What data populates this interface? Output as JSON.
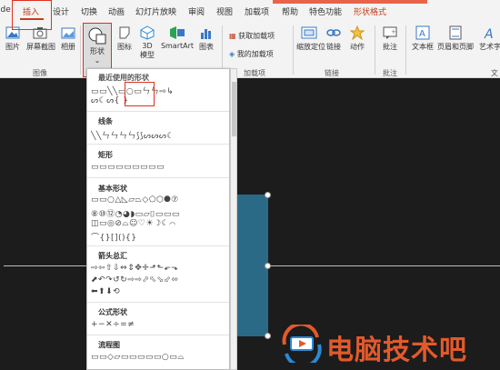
{
  "tabs": [
    {
      "label": "ide"
    },
    {
      "label": "插入"
    },
    {
      "label": "设计"
    },
    {
      "label": "切换"
    },
    {
      "label": "动画"
    },
    {
      "label": "幻灯片放映"
    },
    {
      "label": "审阅"
    },
    {
      "label": "视图"
    },
    {
      "label": "加载项"
    },
    {
      "label": "帮助"
    },
    {
      "label": "特色功能"
    },
    {
      "label": "形状格式"
    }
  ],
  "ribbon": {
    "picture": "图片",
    "screenshot": "屏幕截图",
    "album": "相册",
    "shapes": "形状",
    "icons": "图标",
    "model3d": "3D\n模型",
    "model3d_a": "3D",
    "model3d_b": "模型",
    "smartart": "SmartArt",
    "chart": "图表",
    "get_addins": "获取加载项",
    "my_addins": "我的加载项",
    "zoom": "缩放定位",
    "link": "链接",
    "action": "动作",
    "comment": "批注",
    "textbox": "文本框",
    "header_footer": "页眉和页脚",
    "wordart": "艺术字",
    "groups": {
      "images": "图像",
      "addins": "加载项",
      "links": "链接",
      "comments": "批注",
      "text": "文"
    }
  },
  "dropdown": {
    "sections": {
      "recent": "最近使用的形状",
      "lines": "线条",
      "rectangles": "矩形",
      "basic": "基本形状",
      "arrows": "箭头总汇",
      "equation": "公式形状",
      "flowchart": "流程图"
    },
    "rows": {
      "recent1": "▭▭╲╲▭○▭ㄣㄣ⇨↳",
      "recent2": "ᔕ☾ᔕ{ }",
      "lines": "╲╲ㄣㄣㄣㄣ⟆⟆ᔕᔕᔕ☾",
      "rectangles": "▭▭▭▭▭▭▭▭▭",
      "basic1": "▭▭○△◺▱⏢◇⬠⬡⯃⑦",
      "basic2": "⑧⑩⑫◔◕◗▭▱⌷▭▭▭",
      "basic3": "◫▭◎⊘⌓☺♡☀☽☾⌒",
      "basic4": "⌒{}[](){}",
      "arrows1": "⇨⇦⇧⇩⇔⇕✥✛⬏⬑⬐⬎",
      "arrows2": "⬈↶↷↺↻⇨⇨⬀⬁⬂⬃⬄",
      "arrows3": "⬅⬆⬇⟲",
      "equation": "+−✕÷=≠",
      "flowchart": "▭▭◇▱▭▭▭▭▭○▭⌓"
    }
  },
  "watermark": {
    "text": "电脑技术吧"
  },
  "colors": {
    "accent": "#c43e1c",
    "highlight_box": "#e0301e",
    "shape_fill": "#2b6a87",
    "slide_bg": "#1c1c1c",
    "watermark": "#e25a2b"
  }
}
